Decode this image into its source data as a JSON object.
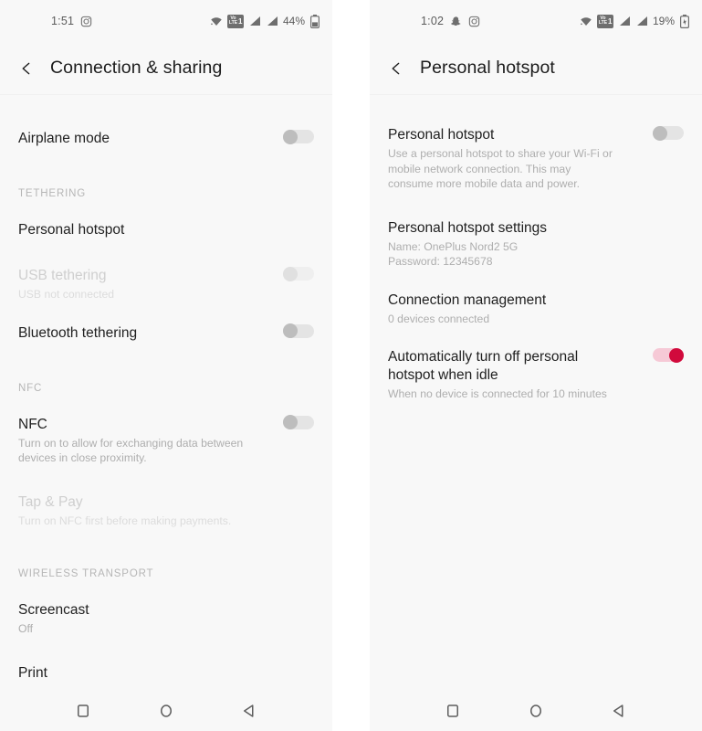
{
  "left_screen": {
    "status_bar": {
      "time": "1:51",
      "icons": [
        "instagram-icon"
      ],
      "right_icons": [
        "wifi-icon",
        "volte-icon",
        "signal-icon",
        "signal-icon"
      ],
      "volte_label_top": "Vo",
      "volte_label_bottom": "LTE",
      "volte_sim": "1",
      "battery_percent": "44%",
      "charging": false
    },
    "header": {
      "back": "back-chevron",
      "title": "Connection & sharing"
    },
    "items": [
      {
        "type": "row",
        "title": "Airplane mode",
        "sub": "",
        "toggle": "off",
        "dim": false
      },
      {
        "type": "section",
        "title": "TETHERING"
      },
      {
        "type": "row",
        "title": "Personal hotspot",
        "sub": "",
        "toggle": "none",
        "dim": false
      },
      {
        "type": "row",
        "title": "USB tethering",
        "sub": "USB not connected",
        "toggle": "disabled",
        "dim": true
      },
      {
        "type": "row",
        "title": "Bluetooth tethering",
        "sub": "",
        "toggle": "off",
        "dim": false
      },
      {
        "type": "section",
        "title": "NFC"
      },
      {
        "type": "row",
        "title": "NFC",
        "sub": "Turn on to allow for exchanging data between devices in close proximity.",
        "toggle": "off",
        "dim": false
      },
      {
        "type": "row",
        "title": "Tap & Pay",
        "sub": "Turn on NFC first before making payments.",
        "toggle": "none",
        "dim": true
      },
      {
        "type": "section",
        "title": "WIRELESS TRANSPORT"
      },
      {
        "type": "row",
        "title": "Screencast",
        "sub": "Off",
        "toggle": "none",
        "dim": false
      },
      {
        "type": "row",
        "title": "Print",
        "sub": "",
        "toggle": "none",
        "dim": false
      }
    ],
    "nav": [
      "recents-square-icon",
      "home-circle-icon",
      "back-triangle-icon"
    ]
  },
  "right_screen": {
    "status_bar": {
      "time": "1:02",
      "icons": [
        "snapchat-icon",
        "instagram-icon"
      ],
      "right_icons": [
        "wifi-icon",
        "volte-icon",
        "signal-icon",
        "signal-icon"
      ],
      "volte_label_top": "Vo",
      "volte_label_bottom": "LTE",
      "volte_sim": "1",
      "battery_percent": "19%",
      "charging": true
    },
    "header": {
      "back": "back-chevron",
      "title": "Personal hotspot"
    },
    "items": [
      {
        "type": "row",
        "title": "Personal hotspot",
        "sub": "Use a personal hotspot to share your Wi-Fi or mobile network connection. This may consume more mobile data and power.",
        "toggle": "off",
        "dim": false
      },
      {
        "type": "row",
        "title": "Personal hotspot settings",
        "sub": "Name: OnePlus Nord2 5G\nPassword: 12345678",
        "toggle": "none",
        "dim": false
      },
      {
        "type": "row",
        "title": "Connection management",
        "sub": "0 devices connected",
        "toggle": "none",
        "dim": false
      },
      {
        "type": "row",
        "title": "Automatically turn off personal hotspot when idle",
        "sub": "When no device is connected for 10 minutes",
        "toggle": "on",
        "dim": false
      }
    ],
    "nav": [
      "recents-square-icon",
      "home-circle-icon",
      "back-triangle-icon"
    ]
  },
  "colors": {
    "panel_bg": "#f8f8f8",
    "page_bg": "#ffffff",
    "title_text": "#1f1f1f",
    "sub_text": "#aeaeae",
    "section_text": "#b6b6b6",
    "accent_on": "#d10a3c",
    "accent_track": "#f6c9d6",
    "toggle_off_track": "#e4e4e4",
    "toggle_off_knob": "#bdbdbd"
  }
}
